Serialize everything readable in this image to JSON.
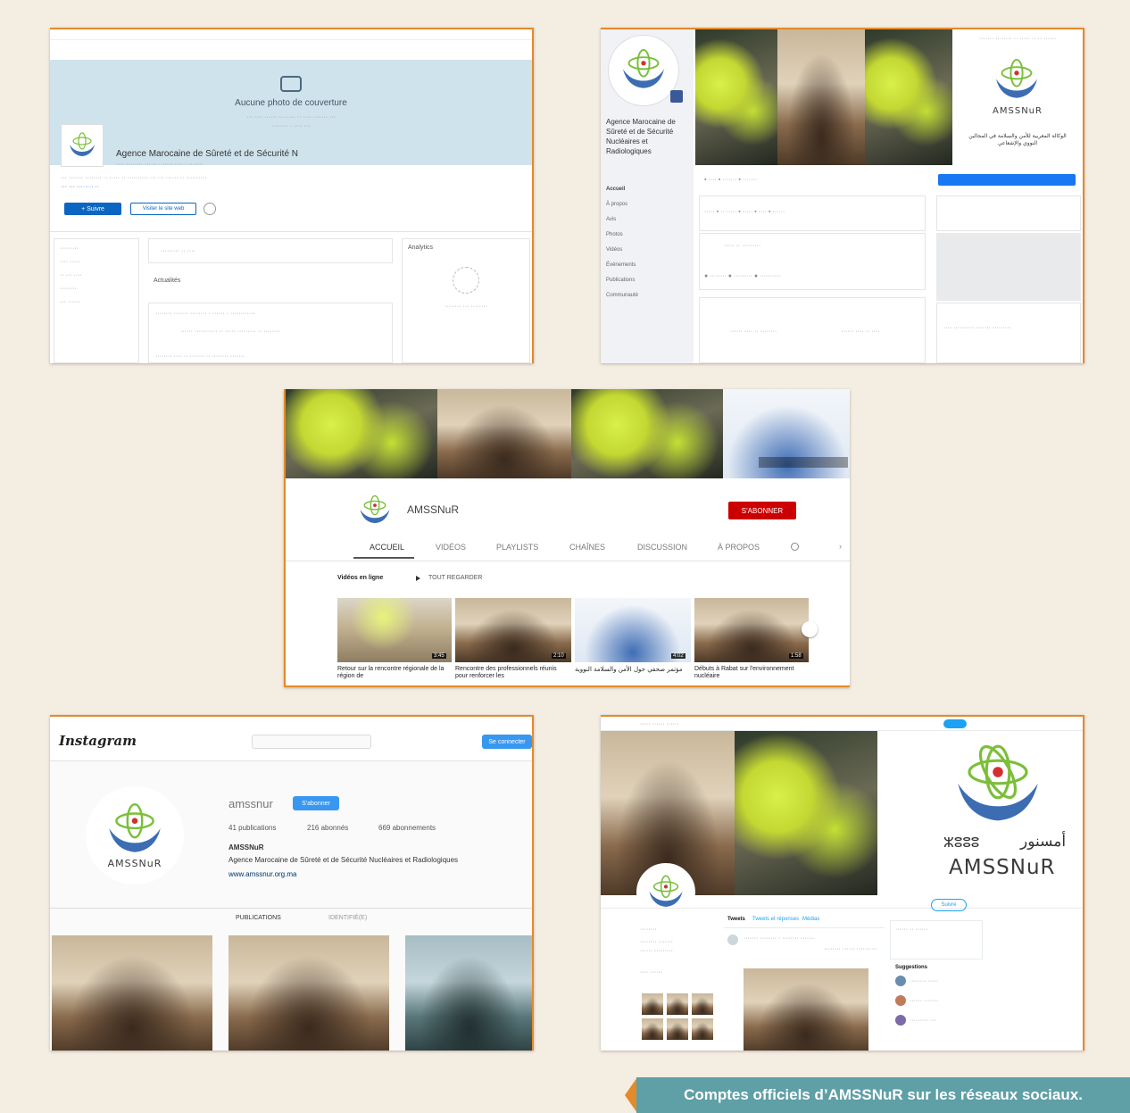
{
  "caption": "Comptes officiels d’AMSSNuR sur les réseaux sociaux.",
  "colors": {
    "background": "#f4ede1",
    "accent_orange": "#e58a2b",
    "caption_teal": "#5f9fa6",
    "linkedin_blue": "#0a66c2",
    "youtube_red": "#cc0000",
    "instagram_blue": "#3897f0",
    "twitter_blue": "#1da1f2"
  },
  "linkedin": {
    "cover_title": "Aucune photo de couverture",
    "org_name": "Agence Marocaine de Sûreté et de Sécurité N",
    "follow_label": "+ Suivre",
    "visit_label": "Visiter le site web",
    "post_section": "Actualités",
    "side_title": "Analytics"
  },
  "facebook": {
    "page_name": "Agence Marocaine de Sûreté et de Sécurité Nucléaires et Radiologiques",
    "logo_brand": "AMSSNuR",
    "logo_arabic": "الوكالة المغربية للأمن والسلامة في المجالين النووي والإشعاعي",
    "nav_items": [
      "Accueil",
      "À propos",
      "Avis",
      "Photos",
      "Vidéos",
      "Événements",
      "Publications",
      "Communauté"
    ]
  },
  "youtube": {
    "channel_name": "AMSSNuR",
    "subscribe_label": "S'ABONNER",
    "tabs": [
      "ACCUEIL",
      "VIDÉOS",
      "PLAYLISTS",
      "CHAÎNES",
      "DISCUSSION",
      "À PROPOS"
    ],
    "section_title": "Vidéos en ligne",
    "section_action": "TOUT REGARDER",
    "videos": [
      {
        "title": "Retour sur la rencontre régionale de la région de",
        "duration": "3:45"
      },
      {
        "title": "Rencontre des professionnels réunis pour renforcer les",
        "duration": "2:10"
      },
      {
        "title": "مؤتمر صحفي حول الأمن والسلامة النووية",
        "duration": "4:02"
      },
      {
        "title": "Débuts à Rabat sur l'environnement nucléaire",
        "duration": "1:58"
      }
    ]
  },
  "instagram": {
    "brand": "Instagram",
    "username": "amssnur",
    "follow_label": "S'abonner",
    "stats": [
      "41 publications",
      "216 abonnés",
      "669 abonnements"
    ],
    "bio_name": "AMSSNuR",
    "bio_text": "Agence Marocaine de Sûreté et de Sécurité Nucléaires et Radiologiques",
    "bio_link": "www.amssnur.org.ma",
    "tabs": [
      "PUBLICATIONS",
      "IDENTIFIÉ(E)"
    ],
    "login_label": "Se connecter",
    "logo_brand": "AMSSNuR"
  },
  "twitter": {
    "logo_brand": "AMSSNuR",
    "logo_arabic": "أمسنور",
    "logo_tifinagh": "ⵣⵓⵓⵓ",
    "tabs": [
      "Tweets",
      "Tweets et réponses",
      "Médias"
    ],
    "follow_label": "Suivre",
    "who_to_follow": "Suggestions"
  }
}
